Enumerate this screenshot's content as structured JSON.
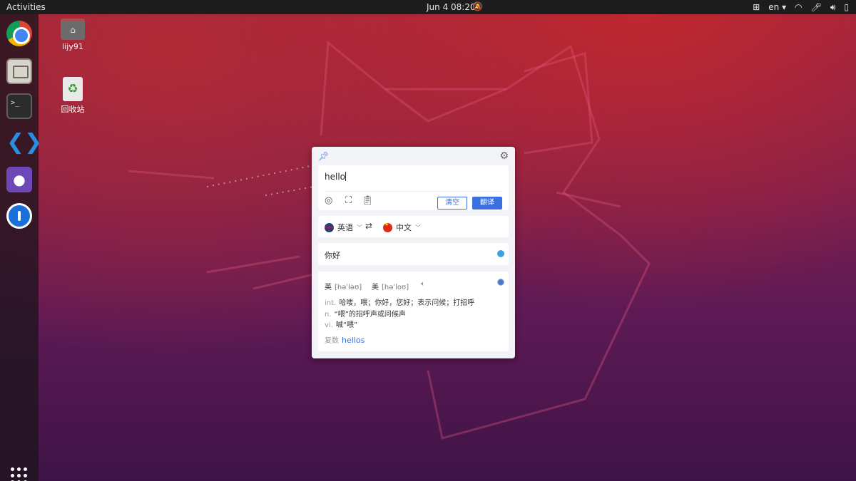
{
  "topbar": {
    "activities": "Activities",
    "clock": "Jun 4  08:20",
    "language": "en ▾"
  },
  "desktop": {
    "home_label": "lijy91",
    "trash_label": "回收站"
  },
  "translator": {
    "input_value": "hello",
    "clear_label": "清空",
    "translate_label": "翻译",
    "source_lang": "英语",
    "target_lang": "中文",
    "result": "你好",
    "phonetic_uk_label": "英",
    "phonetic_uk": "[həˈləʊ]",
    "phonetic_us_label": "美",
    "phonetic_us": "[həˈloʊ]",
    "definitions": [
      {
        "pos": "int.",
        "text": "哈喽，喂；你好，您好；表示问候；打招呼"
      },
      {
        "pos": "n.",
        "text": "“喂”的招呼声或问候声"
      },
      {
        "pos": "vi.",
        "text": "喊“喂”"
      }
    ],
    "plural_label": "复数",
    "plural_word": "hellos"
  },
  "colors": {
    "accent": "#3a6fe0",
    "topbar_bg": "#1d1d1d"
  }
}
